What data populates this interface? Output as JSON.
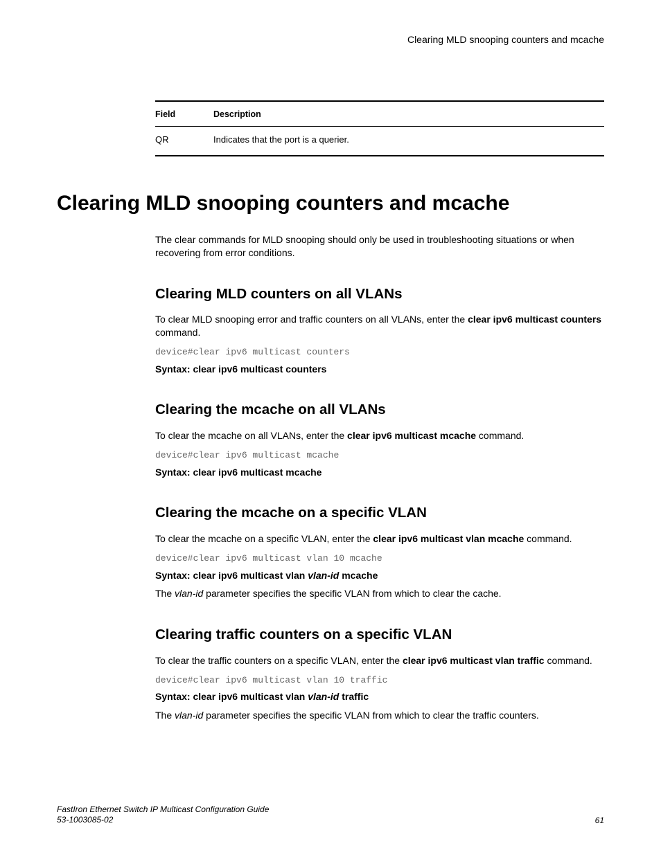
{
  "header": {
    "running_title": "Clearing MLD snooping counters and mcache"
  },
  "table": {
    "head_field": "Field",
    "head_desc": "Description",
    "row_field": "QR",
    "row_desc": "Indicates that the port is a querier."
  },
  "h1": "Clearing MLD snooping counters and mcache",
  "intro": "The clear commands for MLD snooping should only be used in troubleshooting situations or when recovering from error conditions.",
  "s1": {
    "title": "Clearing MLD counters on all VLANs",
    "p_a": "To clear MLD snooping error and traffic counters on all VLANs, enter the ",
    "p_b_bold": "clear ipv6 multicast counters",
    "p_c": " command.",
    "code": "device#clear ipv6 multicast counters",
    "syntax": "Syntax: clear ipv6 multicast counters"
  },
  "s2": {
    "title": "Clearing the mcache on all VLANs",
    "p_a": "To clear the mcache on all VLANs, enter the ",
    "p_b_bold": "clear ipv6 multicast mcache",
    "p_c": " command.",
    "code": "device#clear ipv6 multicast mcache",
    "syntax": "Syntax: clear ipv6 multicast mcache"
  },
  "s3": {
    "title": "Clearing the mcache on a specific VLAN",
    "p_a": "To clear the mcache on a specific VLAN, enter the ",
    "p_b_bold": "clear ipv6 multicast vlan mcache",
    "p_c": " command.",
    "code": "device#clear ipv6 multicast vlan 10 mcache",
    "syntax_a": "Syntax: clear ipv6 multicast vlan ",
    "syntax_b_it": "vlan-id",
    "syntax_c": " mcache",
    "desc_a": "The ",
    "desc_b_it": "vlan-id",
    "desc_c": " parameter specifies the specific VLAN from which to clear the cache."
  },
  "s4": {
    "title": "Clearing traffic counters on a specific VLAN",
    "p_a": "To clear the traffic counters on a specific VLAN, enter the ",
    "p_b_bold": "clear ipv6 multicast vlan traffic",
    "p_c": " command.",
    "code": "device#clear ipv6 multicast vlan 10 traffic",
    "syntax_a": "Syntax: clear ipv6 multicast vlan ",
    "syntax_b_it": "vlan-id",
    "syntax_c": " traffic",
    "desc_a": "The ",
    "desc_b_it": "vlan-id",
    "desc_c": " parameter specifies the specific VLAN from which to clear the traffic counters."
  },
  "footer": {
    "title": "FastIron Ethernet Switch IP Multicast Configuration Guide",
    "docnum": "53-1003085-02",
    "page": "61"
  }
}
